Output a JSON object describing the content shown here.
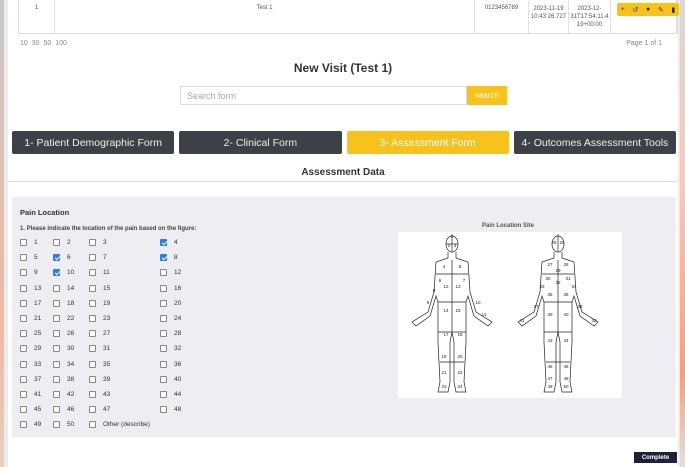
{
  "table_row": {
    "number": "1",
    "name": "Test 1",
    "phone": "0123456789",
    "created": "2023-11-19 10:43:26.727",
    "updated": "2023-12-31T17:54:11.4 19+00:00"
  },
  "action_icons": [
    "+",
    "↺",
    "●",
    "✎",
    "▮"
  ],
  "pager": {
    "sizes": "10 30 50 100",
    "page_info": "Page 1 of 1"
  },
  "visit_title": "New Visit (Test 1)",
  "search": {
    "placeholder": "Search form",
    "button_label": "search"
  },
  "tabs": [
    {
      "label": "1- Patient Demographic Form",
      "active": false
    },
    {
      "label": "2- Clinical Form",
      "active": false
    },
    {
      "label": "3- Assessment Form",
      "active": true
    },
    {
      "label": "4- Outcomes Assessment Tools",
      "active": false
    }
  ],
  "section_title": "Assessment Data",
  "pain": {
    "title": "Pain Location",
    "question": "1. Please indicate the location of the pain based on the figure:",
    "site_label": "Pain Location Site",
    "checkbox_rows": [
      [
        {
          "label": "1",
          "checked": false
        },
        {
          "label": "2",
          "checked": false
        },
        {
          "label": "3",
          "checked": false
        },
        {
          "label": "4",
          "checked": true
        }
      ],
      [
        {
          "label": "5",
          "checked": false
        },
        {
          "label": "6",
          "checked": true
        },
        {
          "label": "7",
          "checked": false
        },
        {
          "label": "8",
          "checked": true
        }
      ],
      [
        {
          "label": "9",
          "checked": false
        },
        {
          "label": "10",
          "checked": true
        },
        {
          "label": "11",
          "checked": false
        },
        {
          "label": "12",
          "checked": false
        }
      ],
      [
        {
          "label": "13",
          "checked": false
        },
        {
          "label": "14",
          "checked": false
        },
        {
          "label": "15",
          "checked": false
        },
        {
          "label": "16",
          "checked": false
        }
      ],
      [
        {
          "label": "17",
          "checked": false
        },
        {
          "label": "18",
          "checked": false
        },
        {
          "label": "19",
          "checked": false
        },
        {
          "label": "20",
          "checked": false
        }
      ],
      [
        {
          "label": "21",
          "checked": false
        },
        {
          "label": "22",
          "checked": false
        },
        {
          "label": "23",
          "checked": false
        },
        {
          "label": "24",
          "checked": false
        }
      ],
      [
        {
          "label": "25",
          "checked": false
        },
        {
          "label": "26",
          "checked": false
        },
        {
          "label": "27",
          "checked": false
        },
        {
          "label": "28",
          "checked": false
        }
      ],
      [
        {
          "label": "29",
          "checked": false
        },
        {
          "label": "30",
          "checked": false
        },
        {
          "label": "31",
          "checked": false
        },
        {
          "label": "32",
          "checked": false
        }
      ],
      [
        {
          "label": "33",
          "checked": false
        },
        {
          "label": "34",
          "checked": false
        },
        {
          "label": "35",
          "checked": false
        },
        {
          "label": "36",
          "checked": false
        }
      ],
      [
        {
          "label": "37",
          "checked": false
        },
        {
          "label": "38",
          "checked": false
        },
        {
          "label": "39",
          "checked": false
        },
        {
          "label": "40",
          "checked": false
        }
      ],
      [
        {
          "label": "41",
          "checked": false
        },
        {
          "label": "42",
          "checked": false
        },
        {
          "label": "43",
          "checked": false
        },
        {
          "label": "44",
          "checked": false
        }
      ],
      [
        {
          "label": "45",
          "checked": false
        },
        {
          "label": "46",
          "checked": false
        },
        {
          "label": "47",
          "checked": false
        },
        {
          "label": "48",
          "checked": false
        }
      ],
      [
        {
          "label": "49",
          "checked": false
        },
        {
          "label": "50",
          "checked": false
        },
        {
          "label": "Other (describe)",
          "checked": false
        }
      ]
    ]
  },
  "front_numbers": [
    "1",
    "2",
    "3",
    "4",
    "5",
    "6",
    "7",
    "8",
    "12",
    "13",
    "9",
    "14",
    "15",
    "10",
    "11",
    "17",
    "18",
    "19",
    "20",
    "21",
    "22",
    "23",
    "24"
  ],
  "back_numbers": [
    "25",
    "26",
    "27",
    "28",
    "29",
    "30",
    "31",
    "32",
    "33",
    "34",
    "35",
    "36",
    "37",
    "38",
    "39",
    "40",
    "41",
    "42",
    "43",
    "44",
    "45",
    "46",
    "47",
    "48",
    "49",
    "50"
  ],
  "complete_label": "Complete",
  "colors": {
    "accent": "#f7c21a",
    "tab_dark": "#3c4147",
    "checkbox": "#2f7de1",
    "complete_button": "#1f2237"
  }
}
